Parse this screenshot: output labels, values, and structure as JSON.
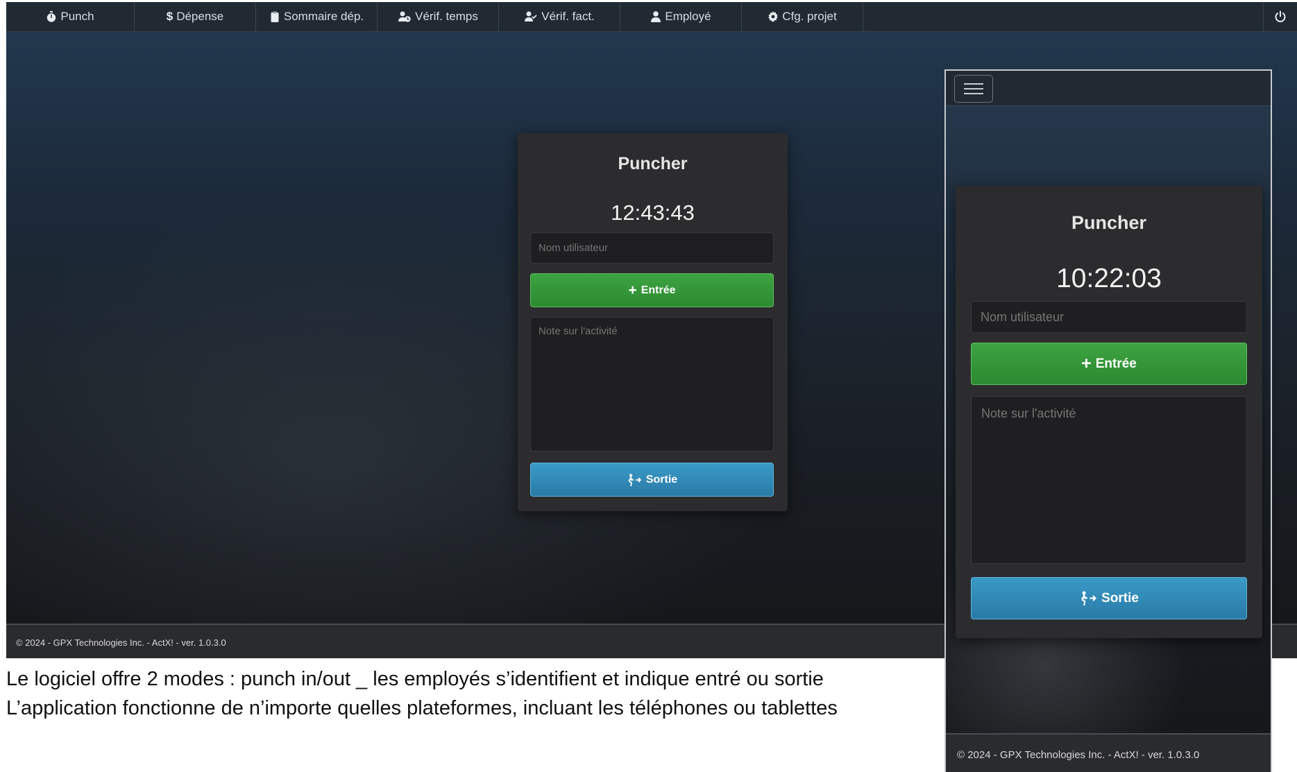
{
  "nav": {
    "items": [
      {
        "label": "Punch",
        "icon": "stopwatch-icon"
      },
      {
        "label": "Dépense",
        "icon": "dollar-icon"
      },
      {
        "label": "Sommaire dép.",
        "icon": "clipboard-icon"
      },
      {
        "label": "Vérif. temps",
        "icon": "user-clock-icon"
      },
      {
        "label": "Vérif. fact.",
        "icon": "user-check-icon"
      },
      {
        "label": "Employé",
        "icon": "user-icon"
      },
      {
        "label": "Cfg. projet",
        "icon": "gear-icon"
      }
    ],
    "power_icon": "power-icon"
  },
  "desktop_card": {
    "title": "Puncher",
    "clock": "12:43:43",
    "username_placeholder": "Nom utilisateur",
    "in_label": "Entrée",
    "note_placeholder": "Note sur l'activité",
    "out_label": "Sortie"
  },
  "mobile_card": {
    "title": "Puncher",
    "clock": "10:22:03",
    "username_placeholder": "Nom utilisateur",
    "in_label": "Entrée",
    "note_placeholder": "Note sur l'activité",
    "out_label": "Sortie"
  },
  "footer_text": "© 2024 - GPX Technologies Inc. - ActX! - ver. 1.0.3.0",
  "caption": {
    "line1": "Le logiciel offre 2 modes : punch in/out _ les employés s’identifient et indique entré ou sortie",
    "line2": "L’application fonctionne de n’importe quelles plateformes, incluant les téléphones ou tablettes"
  },
  "colors": {
    "accent_green": "#3ea342",
    "accent_blue": "#3a9ac7",
    "navbar_bg": "#212933",
    "card_bg": "#2c2c2e"
  }
}
